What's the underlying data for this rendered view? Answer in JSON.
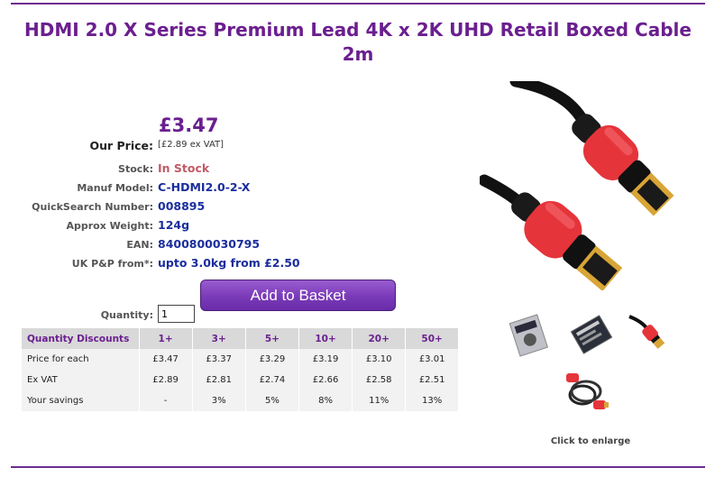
{
  "product": {
    "title": "HDMI 2.0 X Series Premium Lead 4K x 2K UHD Retail Boxed Cable 2m",
    "price": "£3.47",
    "price_label": "Our Price:",
    "ex_vat_note": "[£2.89 ex VAT]"
  },
  "details": [
    {
      "label": "Stock:",
      "value": "In Stock"
    },
    {
      "label": "Manuf Model:",
      "value": "C-HDMI2.0-2-X"
    },
    {
      "label": "QuickSearch Number:",
      "value": "008895"
    },
    {
      "label": "Approx Weight:",
      "value": "124g"
    },
    {
      "label": "EAN:",
      "value": "8400800030795"
    },
    {
      "label": "UK P&P from*:",
      "value": "upto 3.0kg from £2.50"
    }
  ],
  "basket": {
    "button_label": "Add to Basket",
    "quantity_label": "Quantity:",
    "quantity_value": "1"
  },
  "discounts": {
    "header": [
      "Quantity Discounts",
      "1+",
      "3+",
      "5+",
      "10+",
      "20+",
      "50+"
    ],
    "rows": [
      [
        "Price for each",
        "£3.47",
        "£3.37",
        "£3.29",
        "£3.19",
        "£3.10",
        "£3.01"
      ],
      [
        "Ex VAT",
        "£2.89",
        "£2.81",
        "£2.74",
        "£2.66",
        "£2.58",
        "£2.51"
      ],
      [
        "Your savings",
        "-",
        "3%",
        "5%",
        "8%",
        "11%",
        "13%"
      ]
    ]
  },
  "gallery": {
    "caption": "Click to enlarge",
    "thumbnails": [
      "box-front-thumbnail",
      "box-back-thumbnail",
      "cable-red-thumbnail",
      "cable-coiled-thumbnail"
    ]
  },
  "colors": {
    "brand_purple": "#6b1f8f",
    "value_blue": "#1a2d9c",
    "stock_red": "#c15a66",
    "connector_red": "#e5343a"
  }
}
